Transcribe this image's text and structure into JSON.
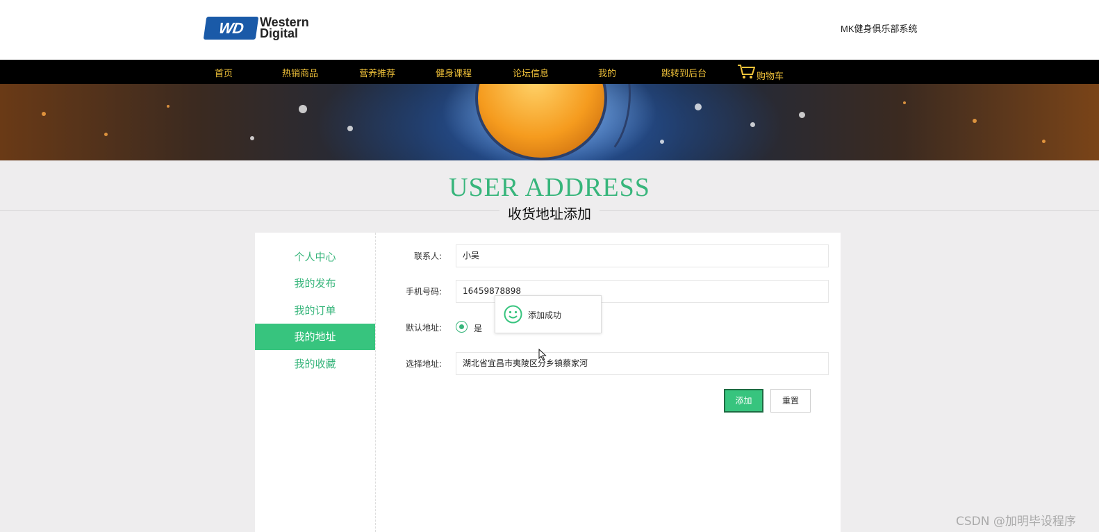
{
  "header": {
    "logo_line1": "Western",
    "logo_line2": "Digital",
    "logo_badge": "WD",
    "system_name": "MK健身俱乐部系统"
  },
  "nav": {
    "items": [
      "首页",
      "热销商品",
      "营养推荐",
      "健身课程",
      "论坛信息",
      "我的",
      "跳转到后台"
    ],
    "cart_label": "购物车",
    "text_color": "#f2c33a"
  },
  "page": {
    "title_en": "USER ADDRESS",
    "title_cn": "收货地址添加",
    "accent_color": "#37c47e"
  },
  "sidebar": {
    "items": [
      "个人中心",
      "我的发布",
      "我的订单",
      "我的地址",
      "我的收藏"
    ],
    "active": "我的地址"
  },
  "form": {
    "contact_label": "联系人:",
    "contact_value": "小吴",
    "phone_label": "手机号码:",
    "phone_value": "16459878898",
    "default_label": "默认地址:",
    "default_yes": "是",
    "default_selected": "是",
    "address_label": "选择地址:",
    "address_value": "湖北省宜昌市夷陵区分乡镇蔡家河",
    "submit_label": "添加",
    "reset_label": "重置"
  },
  "toast": {
    "message": "添加成功",
    "icon": "smile-icon"
  },
  "watermark": "CSDN @加明毕设程序"
}
